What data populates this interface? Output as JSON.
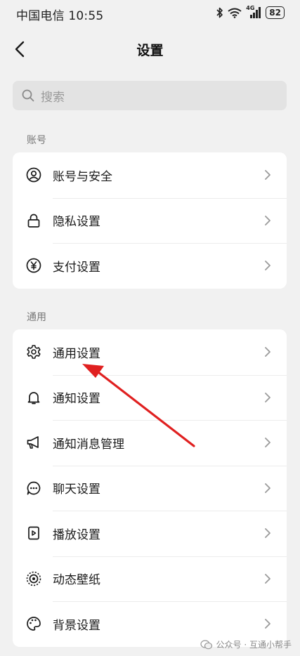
{
  "status_bar": {
    "carrier_time": "中国电信 10:55",
    "network": "4G",
    "battery": "82"
  },
  "header": {
    "title": "设置"
  },
  "search": {
    "placeholder": "搜索"
  },
  "sections": {
    "account": {
      "label": "账号",
      "items": [
        {
          "label": "账号与安全",
          "icon": "user-circle-icon"
        },
        {
          "label": "隐私设置",
          "icon": "lock-icon"
        },
        {
          "label": "支付设置",
          "icon": "yuan-icon"
        }
      ]
    },
    "general": {
      "label": "通用",
      "items": [
        {
          "label": "通用设置",
          "icon": "gear-icon"
        },
        {
          "label": "通知设置",
          "icon": "bell-icon"
        },
        {
          "label": "通知消息管理",
          "icon": "megaphone-icon"
        },
        {
          "label": "聊天设置",
          "icon": "chat-bubble-icon"
        },
        {
          "label": "播放设置",
          "icon": "play-device-icon"
        },
        {
          "label": "动态壁纸",
          "icon": "live-wallpaper-icon"
        },
        {
          "label": "背景设置",
          "icon": "palette-icon"
        }
      ]
    }
  },
  "annotation": {
    "arrow_color": "#e02020"
  },
  "watermark": {
    "text": "公众号 · 互通小帮手"
  }
}
